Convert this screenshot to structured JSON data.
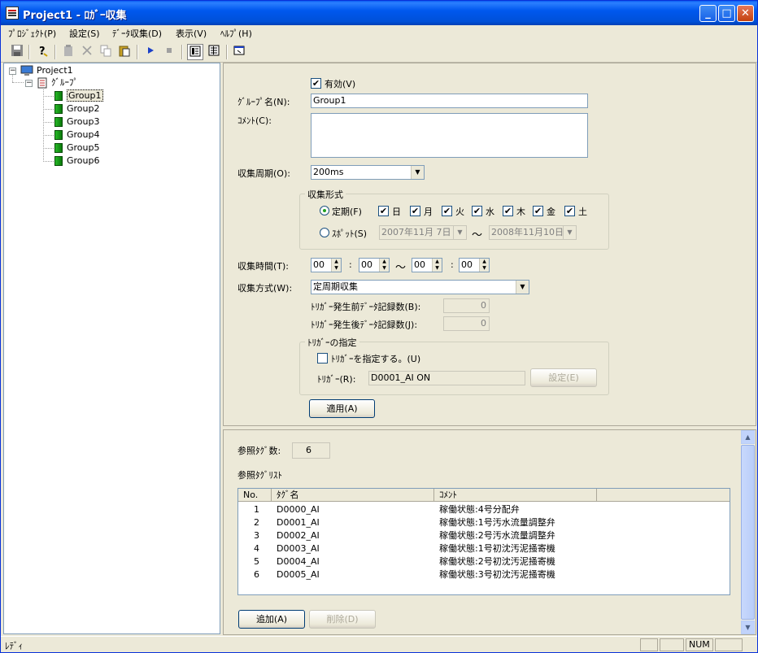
{
  "window": {
    "title": "Project1 - ﾛｶﾞｰ収集",
    "min": "_",
    "max": "□",
    "close": "✕"
  },
  "menu": [
    "ﾌﾟﾛｼﾞｪｸﾄ(P)",
    "設定(S)",
    "ﾃﾞｰﾀ収集(D)",
    "表示(V)",
    "ﾍﾙﾌﾟ(H)"
  ],
  "toolbar": {
    "icons": [
      "save-icon",
      "help-icon",
      "delete-group-icon",
      "cut-icon",
      "copy-icon",
      "paste-icon",
      "play-icon",
      "stop-icon",
      "view-list-icon",
      "view-detail-icon",
      "window-icon"
    ]
  },
  "tree": {
    "root": "Project1",
    "group_folder": "ｸﾞﾙｰﾌﾟ",
    "groups": [
      "Group1",
      "Group2",
      "Group3",
      "Group4",
      "Group5",
      "Group6"
    ],
    "expand_glyph": "−"
  },
  "form": {
    "enabled_label": "有効(V)",
    "enabled_checked": "✔",
    "group_name_label": "ｸﾞﾙｰﾌﾟ名(N):",
    "group_name_value": "Group1",
    "comment_label": "ｺﾒﾝﾄ(C):",
    "comment_value": "",
    "period_label": "収集周期(O):",
    "period_value": "200ms",
    "format_group_title": "収集形式",
    "periodic_label": "定期(F)",
    "days": [
      {
        "label": "日",
        "checked": "✔"
      },
      {
        "label": "月",
        "checked": "✔"
      },
      {
        "label": "火",
        "checked": "✔"
      },
      {
        "label": "水",
        "checked": "✔"
      },
      {
        "label": "木",
        "checked": "✔"
      },
      {
        "label": "金",
        "checked": "✔"
      },
      {
        "label": "土",
        "checked": "✔"
      }
    ],
    "spot_label": "ｽﾎﾟｯﾄ(S)",
    "spot_from": "2007年11月 7日",
    "spot_tilde": "〜",
    "spot_to": "2008年11月10日",
    "time_label": "収集時間(T):",
    "time_values": [
      "00",
      "00",
      "00",
      "00"
    ],
    "time_colon": ":",
    "time_tilde": "〜",
    "method_label": "収集方式(W):",
    "method_value": "定周期収集",
    "before_label": "ﾄﾘｶﾞｰ発生前ﾃﾞｰﾀ記録数(B):",
    "before_value": "0",
    "after_label": "ﾄﾘｶﾞｰ発生後ﾃﾞｰﾀ記録数(J):",
    "after_value": "0",
    "trigger_group_title": "ﾄﾘｶﾞｰの指定",
    "trigger_check_label": "ﾄﾘｶﾞｰを指定する。(U)",
    "trigger_label": "ﾄﾘｶﾞｰ(R):",
    "trigger_value": "D0001_AI ON",
    "trigger_set_button": "設定(E)",
    "apply_button": "適用(A)"
  },
  "ref": {
    "count_label": "参照ﾀｸﾞ数:",
    "count_value": "6",
    "list_label": "参照ﾀｸﾞﾘｽﾄ",
    "columns": [
      "No.",
      "ﾀｸﾞ名",
      "ｺﾒﾝﾄ"
    ],
    "rows": [
      {
        "no": "1",
        "tag": "D0000_AI",
        "comment": "稼働状態:4号分配弁"
      },
      {
        "no": "2",
        "tag": "D0001_AI",
        "comment": "稼働状態:1号汚水流量調整弁"
      },
      {
        "no": "3",
        "tag": "D0002_AI",
        "comment": "稼働状態:2号汚水流量調整弁"
      },
      {
        "no": "4",
        "tag": "D0003_AI",
        "comment": "稼働状態:1号初沈汚泥掻寄機"
      },
      {
        "no": "5",
        "tag": "D0004_AI",
        "comment": "稼働状態:2号初沈汚泥掻寄機"
      },
      {
        "no": "6",
        "tag": "D0005_AI",
        "comment": "稼働状態:3号初沈汚泥掻寄機"
      }
    ],
    "add_button": "追加(A)",
    "delete_button": "削除(D)"
  },
  "status": {
    "text": "ﾚﾃﾞｨ",
    "num": "NUM"
  }
}
